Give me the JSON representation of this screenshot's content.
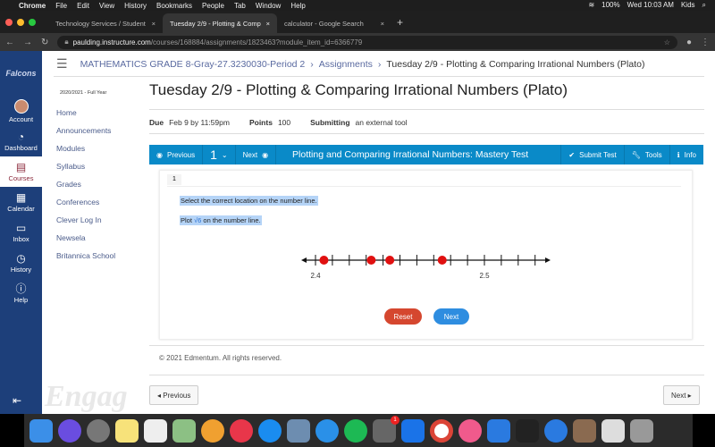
{
  "menubar": {
    "items": [
      "Chrome",
      "File",
      "Edit",
      "View",
      "History",
      "Bookmarks",
      "People",
      "Tab",
      "Window",
      "Help"
    ],
    "battery": "100%",
    "clock": "Wed 10:03 AM",
    "user": "Kids"
  },
  "tabs": [
    {
      "label": "Technology Services / Student"
    },
    {
      "label": "Tuesday 2/9 - Plotting & Comp"
    },
    {
      "label": "calculator - Google Search"
    }
  ],
  "address": {
    "domain": "paulding.instructure.com",
    "path": "/courses/168884/assignments/1823463?module_item_id=6366779"
  },
  "global_nav": [
    {
      "label": "Account",
      "icon": "avatar"
    },
    {
      "label": "Dashboard",
      "icon": "dashboard-icon"
    },
    {
      "label": "Courses",
      "icon": "book-icon"
    },
    {
      "label": "Calendar",
      "icon": "calendar-icon"
    },
    {
      "label": "Inbox",
      "icon": "inbox-icon"
    },
    {
      "label": "History",
      "icon": "clock-icon"
    },
    {
      "label": "Help",
      "icon": "help-icon"
    }
  ],
  "breadcrumb": {
    "course": "MATHEMATICS GRADE 8-Gray-27.3230030-Period 2",
    "section": "Assignments",
    "current": "Tuesday 2/9 - Plotting & Comparing Irrational Numbers (Plato)"
  },
  "course_nav": {
    "term": "2020/2021 - Full Year",
    "items": [
      "Home",
      "Announcements",
      "Modules",
      "Syllabus",
      "Grades",
      "Conferences",
      "Clever Log In",
      "Newsela",
      "Britannica School"
    ]
  },
  "assignment": {
    "title": "Tuesday 2/9 - Plotting & Comparing Irrational Numbers (Plato)",
    "due_label": "Due",
    "due": "Feb 9 by 11:59pm",
    "points_label": "Points",
    "points": "100",
    "submitting_label": "Submitting",
    "submitting": "an external tool"
  },
  "toolbar": {
    "previous": "Previous",
    "number": "1",
    "next": "Next",
    "test_title": "Plotting and Comparing Irrational Numbers: Mastery Test",
    "submit": "Submit Test",
    "tools": "Tools",
    "info": "Info",
    "color": "#0a8ac8"
  },
  "question": {
    "number": "1",
    "instruction": "Select the correct location on the number line.",
    "prompt_pre": "Plot ",
    "prompt_math": "√6",
    "prompt_post": " on the number line.",
    "reset": "Reset",
    "next": "Next"
  },
  "number_line": {
    "min": 2.4,
    "max": 2.53,
    "step": 0.01,
    "labels": [
      {
        "value": 2.4,
        "text": "2.4"
      },
      {
        "value": 2.5,
        "text": "2.5"
      }
    ],
    "points": [
      2.405,
      2.433,
      2.444,
      2.475
    ],
    "point_color": "#e01010"
  },
  "footer": {
    "copyright": "© 2021 Edmentum. All rights reserved.",
    "previous": "Previous",
    "next": "Next",
    "watermark": "Engag"
  },
  "dock": {
    "badge": "1"
  }
}
